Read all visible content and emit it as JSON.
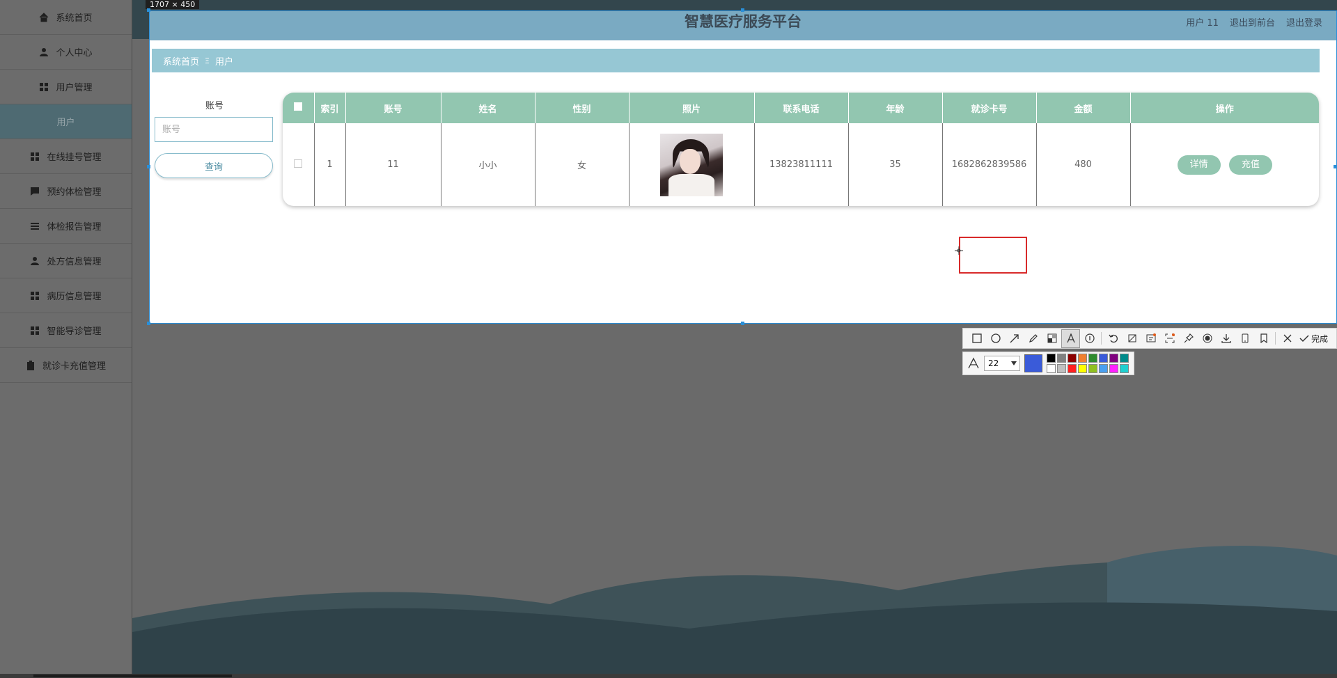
{
  "sidebar": {
    "items": [
      {
        "label": "系统首页",
        "icon": "home-icon"
      },
      {
        "label": "个人中心",
        "icon": "person-icon"
      },
      {
        "label": "用户管理",
        "icon": "grid-icon"
      },
      {
        "label": "用户",
        "icon": ""
      },
      {
        "label": "在线挂号管理",
        "icon": "grid-icon"
      },
      {
        "label": "预约体检管理",
        "icon": "chat-icon"
      },
      {
        "label": "体检报告管理",
        "icon": "list-icon"
      },
      {
        "label": "处方信息管理",
        "icon": "person-icon"
      },
      {
        "label": "病历信息管理",
        "icon": "grid-icon"
      },
      {
        "label": "智能导诊管理",
        "icon": "grid-icon"
      },
      {
        "label": "就诊卡充值管理",
        "icon": "clipboard-icon"
      }
    ],
    "active_index": 3
  },
  "capture": {
    "size_label": "1707 × 450"
  },
  "header": {
    "title": "智慧医疗服务平台",
    "user_label": "用户 11",
    "front_label": "退出到前台",
    "logout_label": "退出登录"
  },
  "breadcrumb": {
    "home": "系统首页",
    "separator": "Ξ",
    "current": "用户"
  },
  "search": {
    "label": "账号",
    "placeholder": "账号",
    "button": "查询"
  },
  "table": {
    "columns": [
      "索引",
      "账号",
      "姓名",
      "性别",
      "照片",
      "联系电话",
      "年龄",
      "就诊卡号",
      "金额",
      "操作"
    ],
    "rows": [
      {
        "index": "1",
        "account": "11",
        "name": "小小",
        "gender": "女",
        "phone": "13823811111",
        "age": "35",
        "card_no": "1682862839586",
        "amount": "480",
        "actions": [
          "详情",
          "充值"
        ]
      }
    ]
  },
  "toolbar": {
    "tools": [
      "rectangle-icon",
      "ellipse-icon",
      "arrow-icon",
      "pencil-icon",
      "mosaic-icon",
      "text-icon",
      "number-icon",
      "undo-icon",
      "crop-icon",
      "ocr-icon",
      "scan-icon",
      "pin-icon",
      "record-icon",
      "save-icon",
      "device-icon",
      "bookmark-icon",
      "close-icon"
    ],
    "done_label": "完成",
    "font_size": "22",
    "current_color": "#3a5bd9",
    "palette": [
      "#000000",
      "#808080",
      "#8b0000",
      "#f08030",
      "#2e8b2e",
      "#3a5bd9",
      "#800080",
      "#008b8b",
      "#ffffff",
      "#c0c0c0",
      "#ff2020",
      "#ffff00",
      "#90c020",
      "#4aa0f0",
      "#ff20ff",
      "#20d0d0"
    ]
  }
}
